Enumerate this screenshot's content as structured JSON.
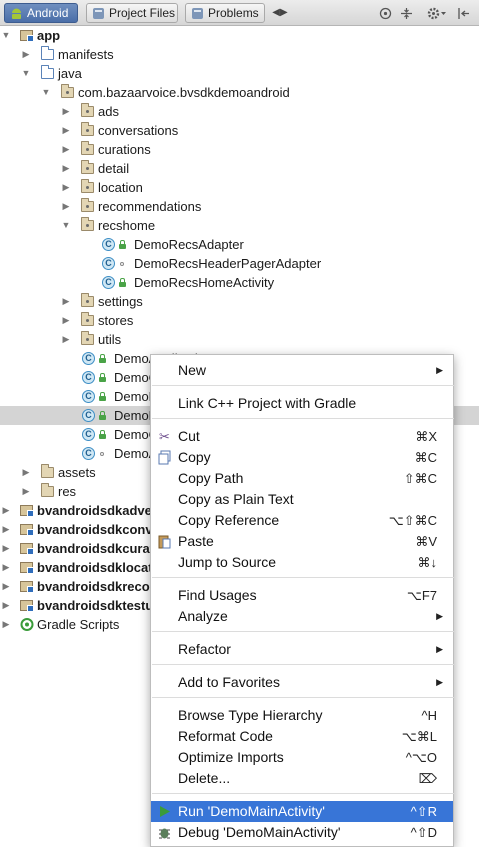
{
  "toolbar": {
    "tabs": [
      {
        "label": "Android",
        "active": true
      },
      {
        "label": "Project Files",
        "active": false
      },
      {
        "label": "Problems",
        "active": false
      }
    ],
    "overflow_glyph": "◀▶",
    "icons": [
      "crosshair-icon",
      "collapse-icon",
      "gear-icon",
      "hide-icon"
    ]
  },
  "tree": {
    "rows": [
      {
        "label": "app",
        "bold": true,
        "arrow": "down",
        "icon": "module"
      },
      {
        "label": "manifests",
        "arrow": "right",
        "icon": "folder-blue"
      },
      {
        "label": "java",
        "arrow": "down",
        "icon": "folder-blue"
      },
      {
        "label": "com.bazaarvoice.bvsdkdemoandroid",
        "arrow": "down",
        "icon": "package"
      },
      {
        "label": "ads",
        "arrow": "right",
        "icon": "package"
      },
      {
        "label": "conversations",
        "arrow": "right",
        "icon": "package"
      },
      {
        "label": "curations",
        "arrow": "right",
        "icon": "package"
      },
      {
        "label": "detail",
        "arrow": "right",
        "icon": "package"
      },
      {
        "label": "location",
        "arrow": "right",
        "icon": "package"
      },
      {
        "label": "recommendations",
        "arrow": "right",
        "icon": "package"
      },
      {
        "label": "recshome",
        "arrow": "down",
        "icon": "package"
      },
      {
        "label": "DemoRecsAdapter",
        "icon": "class-lock"
      },
      {
        "label": "DemoRecsHeaderPagerAdapter",
        "icon": "class-dot"
      },
      {
        "label": "DemoRecsHomeActivity",
        "icon": "class-lock"
      },
      {
        "label": "settings",
        "arrow": "right",
        "icon": "package"
      },
      {
        "label": "stores",
        "arrow": "right",
        "icon": "package"
      },
      {
        "label": "utils",
        "arrow": "right",
        "icon": "package"
      },
      {
        "label": "DemoApplication",
        "icon": "class-lock"
      },
      {
        "label": "DemoConstants",
        "icon": "class-lock"
      },
      {
        "label": "DemoLoginActivity",
        "icon": "class-lock"
      },
      {
        "label": "DemoMainActivity",
        "icon": "class-lock",
        "selected": true
      },
      {
        "label": "DemoClientConfigUtils",
        "icon": "class-lock"
      },
      {
        "label": "DemoAppConfigurationFor",
        "icon": "class-dot"
      },
      {
        "label": "assets",
        "arrow": "right",
        "icon": "folder-res"
      },
      {
        "label": "res",
        "arrow": "right",
        "icon": "folder-res"
      },
      {
        "label": "bvandroidsdkadvertising",
        "bold": true,
        "arrow": "right",
        "icon": "module"
      },
      {
        "label": "bvandroidsdkconversations",
        "bold": true,
        "arrow": "right",
        "icon": "module"
      },
      {
        "label": "bvandroidsdkcurations",
        "bold": true,
        "arrow": "right",
        "icon": "module"
      },
      {
        "label": "bvandroidsdklocation",
        "bold": true,
        "arrow": "right",
        "icon": "module"
      },
      {
        "label": "bvandroidsdkrecommendations",
        "bold": true,
        "arrow": "right",
        "icon": "module"
      },
      {
        "label": "bvandroidsdktestutils",
        "bold": true,
        "arrow": "right",
        "icon": "module"
      },
      {
        "label": "Gradle Scripts",
        "arrow": "right",
        "icon": "gradle"
      }
    ]
  },
  "context_menu": {
    "items": [
      {
        "label": "New",
        "submenu": true
      },
      {
        "sep": true
      },
      {
        "label": "Link C++ Project with Gradle"
      },
      {
        "sep": true
      },
      {
        "label": "Cut",
        "shortcut": "⌘X",
        "icon": "scissors-icon"
      },
      {
        "label": "Copy",
        "shortcut": "⌘C",
        "icon": "copy-icon"
      },
      {
        "label": "Copy Path",
        "shortcut": "⇧⌘C"
      },
      {
        "label": "Copy as Plain Text"
      },
      {
        "label": "Copy Reference",
        "shortcut": "⌥⇧⌘C"
      },
      {
        "label": "Paste",
        "shortcut": "⌘V",
        "icon": "paste-icon"
      },
      {
        "label": "Jump to Source",
        "shortcut": "⌘↓"
      },
      {
        "sep": true
      },
      {
        "label": "Find Usages",
        "shortcut": "⌥F7"
      },
      {
        "label": "Analyze",
        "submenu": true
      },
      {
        "sep": true
      },
      {
        "label": "Refactor",
        "submenu": true
      },
      {
        "sep": true
      },
      {
        "label": "Add to Favorites",
        "submenu": true
      },
      {
        "sep": true
      },
      {
        "label": "Browse Type Hierarchy",
        "shortcut": "^H"
      },
      {
        "label": "Reformat Code",
        "shortcut": "⌥⌘L"
      },
      {
        "label": "Optimize Imports",
        "shortcut": "^⌥O"
      },
      {
        "label": "Delete...",
        "shortcut": "⌦"
      },
      {
        "sep": true
      },
      {
        "label": "Run 'DemoMainActivity'",
        "shortcut": "^⇧R",
        "icon": "run-icon",
        "highlighted": true
      },
      {
        "label": "Debug 'DemoMainActivity'",
        "shortcut": "^⇧D",
        "icon": "debug-icon"
      }
    ]
  },
  "colors": {
    "highlight": "#3875d7",
    "selected_row": "#d4d4d4",
    "run_green": "#3a9b3a"
  }
}
